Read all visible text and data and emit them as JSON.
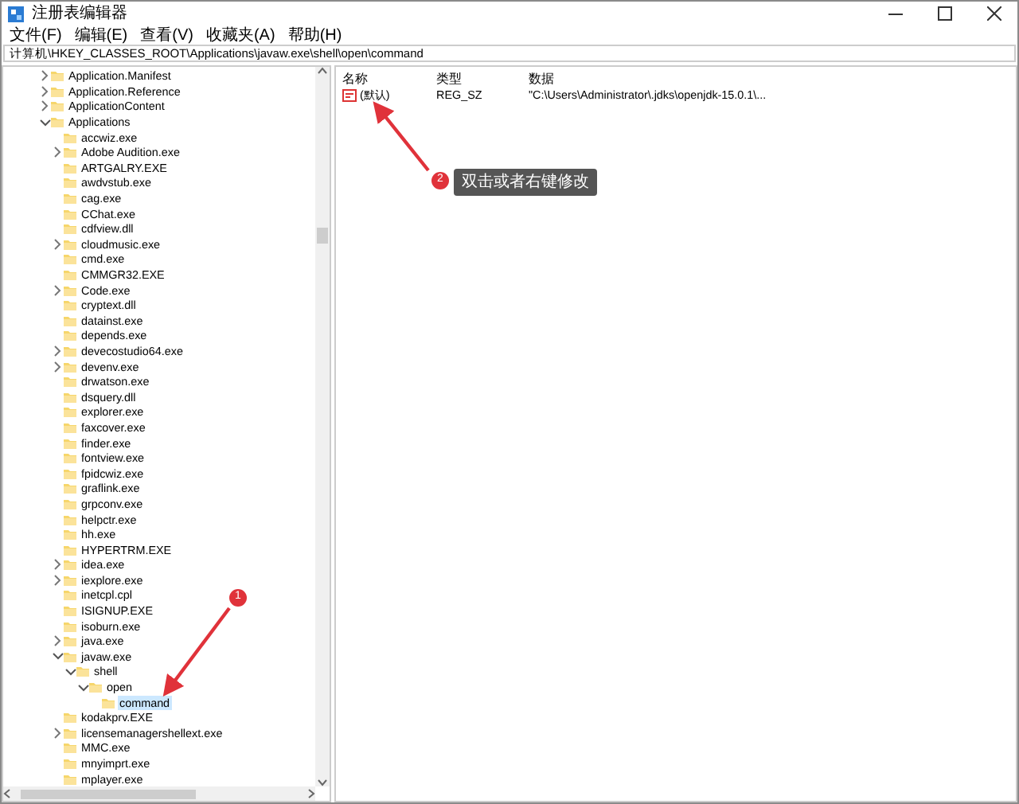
{
  "window": {
    "title": "注册表编辑器"
  },
  "menu": [
    "文件(F)",
    "编辑(E)",
    "查看(V)",
    "收藏夹(A)",
    "帮助(H)"
  ],
  "address": "计算机\\HKEY_CLASSES_ROOT\\Applications\\javaw.exe\\shell\\open\\command",
  "tree": [
    {
      "label": "Application.Manifest",
      "expandable": true,
      "expanded": false,
      "selected": false
    },
    {
      "label": "Application.Reference",
      "expandable": true,
      "expanded": false,
      "selected": false
    },
    {
      "label": "ApplicationContent",
      "expandable": true,
      "expanded": false,
      "selected": false
    },
    {
      "label": "Applications",
      "expandable": true,
      "expanded": true,
      "selected": false,
      "children": [
        {
          "label": "accwiz.exe",
          "expandable": false,
          "selected": false
        },
        {
          "label": "Adobe Audition.exe",
          "expandable": true,
          "expanded": false,
          "selected": false
        },
        {
          "label": "ARTGALRY.EXE",
          "expandable": false,
          "selected": false
        },
        {
          "label": "awdvstub.exe",
          "expandable": false,
          "selected": false
        },
        {
          "label": "cag.exe",
          "expandable": false,
          "selected": false
        },
        {
          "label": "CChat.exe",
          "expandable": false,
          "selected": false
        },
        {
          "label": "cdfview.dll",
          "expandable": false,
          "selected": false
        },
        {
          "label": "cloudmusic.exe",
          "expandable": true,
          "expanded": false,
          "selected": false
        },
        {
          "label": "cmd.exe",
          "expandable": false,
          "selected": false
        },
        {
          "label": "CMMGR32.EXE",
          "expandable": false,
          "selected": false
        },
        {
          "label": "Code.exe",
          "expandable": true,
          "expanded": false,
          "selected": false
        },
        {
          "label": "cryptext.dll",
          "expandable": false,
          "selected": false
        },
        {
          "label": "datainst.exe",
          "expandable": false,
          "selected": false
        },
        {
          "label": "depends.exe",
          "expandable": false,
          "selected": false
        },
        {
          "label": "devecostudio64.exe",
          "expandable": true,
          "expanded": false,
          "selected": false
        },
        {
          "label": "devenv.exe",
          "expandable": true,
          "expanded": false,
          "selected": false
        },
        {
          "label": "drwatson.exe",
          "expandable": false,
          "selected": false
        },
        {
          "label": "dsquery.dll",
          "expandable": false,
          "selected": false
        },
        {
          "label": "explorer.exe",
          "expandable": false,
          "selected": false
        },
        {
          "label": "faxcover.exe",
          "expandable": false,
          "selected": false
        },
        {
          "label": "finder.exe",
          "expandable": false,
          "selected": false
        },
        {
          "label": "fontview.exe",
          "expandable": false,
          "selected": false
        },
        {
          "label": "fpidcwiz.exe",
          "expandable": false,
          "selected": false
        },
        {
          "label": "graflink.exe",
          "expandable": false,
          "selected": false
        },
        {
          "label": "grpconv.exe",
          "expandable": false,
          "selected": false
        },
        {
          "label": "helpctr.exe",
          "expandable": false,
          "selected": false
        },
        {
          "label": "hh.exe",
          "expandable": false,
          "selected": false
        },
        {
          "label": "HYPERTRM.EXE",
          "expandable": false,
          "selected": false
        },
        {
          "label": "idea.exe",
          "expandable": true,
          "expanded": false,
          "selected": false
        },
        {
          "label": "iexplore.exe",
          "expandable": true,
          "expanded": false,
          "selected": false
        },
        {
          "label": "inetcpl.cpl",
          "expandable": false,
          "selected": false
        },
        {
          "label": "ISIGNUP.EXE",
          "expandable": false,
          "selected": false
        },
        {
          "label": "isoburn.exe",
          "expandable": false,
          "selected": false
        },
        {
          "label": "java.exe",
          "expandable": true,
          "expanded": false,
          "selected": false
        },
        {
          "label": "javaw.exe",
          "expandable": true,
          "expanded": true,
          "selected": false,
          "children": [
            {
              "label": "shell",
              "expandable": true,
              "expanded": true,
              "selected": false,
              "children": [
                {
                  "label": "open",
                  "expandable": true,
                  "expanded": true,
                  "selected": false,
                  "children": [
                    {
                      "label": "command",
                      "expandable": false,
                      "selected": true
                    }
                  ]
                }
              ]
            }
          ]
        },
        {
          "label": "kodakprv.EXE",
          "expandable": false,
          "selected": false
        },
        {
          "label": "licensemanagershellext.exe",
          "expandable": true,
          "expanded": false,
          "selected": false
        },
        {
          "label": "MMC.exe",
          "expandable": false,
          "selected": false
        },
        {
          "label": "mnyimprt.exe",
          "expandable": false,
          "selected": false
        },
        {
          "label": "mplayer.exe",
          "expandable": false,
          "selected": false
        }
      ]
    }
  ],
  "values": {
    "columns": [
      "名称",
      "类型",
      "数据"
    ],
    "rows": [
      {
        "name": "(默认)",
        "type": "REG_SZ",
        "data": "\"C:\\Users\\Administrator\\.jdks\\openjdk-15.0.1\\..."
      }
    ]
  },
  "annotations": [
    {
      "number": "1"
    },
    {
      "number": "2",
      "text": "双击或者右键修改"
    }
  ]
}
